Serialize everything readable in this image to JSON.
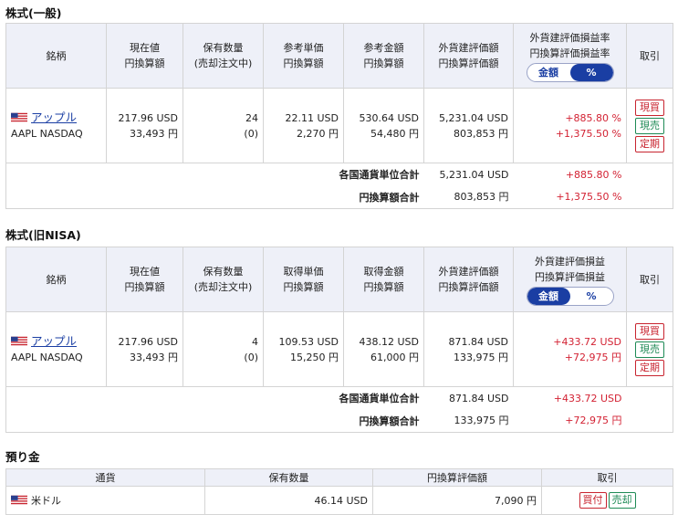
{
  "section1": {
    "title": "株式(一般)",
    "headers": {
      "name": "銘柄",
      "price": [
        "現在値",
        "円換算額"
      ],
      "qty": [
        "保有数量",
        "(売却注文中)"
      ],
      "unit": [
        "参考単価",
        "円換算額"
      ],
      "amount": [
        "参考金額",
        "円換算額"
      ],
      "eval": [
        "外貨建評価額",
        "円換算評価額"
      ],
      "pl": [
        "外貨建評価損益率",
        "円換算評価損益率"
      ],
      "trade": "取引"
    },
    "toggle": {
      "left": "金額",
      "right": "%",
      "active": "right"
    },
    "row": {
      "name": "アップル",
      "ticker": "AAPL NASDAQ",
      "price_usd": "217.96 USD",
      "price_jpy": "33,493 円",
      "qty": "24",
      "qty_selling": "(0)",
      "unit_usd": "22.11 USD",
      "unit_jpy": "2,270 円",
      "amount_usd": "530.64 USD",
      "amount_jpy": "54,480 円",
      "eval_usd": "5,231.04 USD",
      "eval_jpy": "803,853 円",
      "pl_usd": "+885.80 %",
      "pl_jpy": "+1,375.50 %",
      "btn_buy": "現買",
      "btn_sell": "現売",
      "btn_teiki": "定期"
    },
    "sum1": {
      "label": "各国通貨単位合計",
      "eval": "5,231.04 USD",
      "pl": "+885.80 %"
    },
    "sum2": {
      "label": "円換算額合計",
      "eval": "803,853 円",
      "pl": "+1,375.50 %"
    }
  },
  "section2": {
    "title": "株式(旧NISA)",
    "headers": {
      "name": "銘柄",
      "price": [
        "現在値",
        "円換算額"
      ],
      "qty": [
        "保有数量",
        "(売却注文中)"
      ],
      "unit": [
        "取得単価",
        "円換算額"
      ],
      "amount": [
        "取得金額",
        "円換算額"
      ],
      "eval": [
        "外貨建評価額",
        "円換算評価額"
      ],
      "pl": [
        "外貨建評価損益",
        "円換算評価損益"
      ],
      "trade": "取引"
    },
    "toggle": {
      "left": "金額",
      "right": "%",
      "active": "left"
    },
    "row": {
      "name": "アップル",
      "ticker": "AAPL NASDAQ",
      "price_usd": "217.96 USD",
      "price_jpy": "33,493 円",
      "qty": "4",
      "qty_selling": "(0)",
      "unit_usd": "109.53 USD",
      "unit_jpy": "15,250 円",
      "amount_usd": "438.12 USD",
      "amount_jpy": "61,000 円",
      "eval_usd": "871.84 USD",
      "eval_jpy": "133,975 円",
      "pl_usd": "+433.72 USD",
      "pl_jpy": "+72,975 円",
      "btn_buy": "現買",
      "btn_sell": "現売",
      "btn_teiki": "定期"
    },
    "sum1": {
      "label": "各国通貨単位合計",
      "eval": "871.84 USD",
      "pl": "+433.72 USD"
    },
    "sum2": {
      "label": "円換算額合計",
      "eval": "133,975 円",
      "pl": "+72,975 円"
    }
  },
  "section3": {
    "title": "預り金",
    "headers": {
      "currency": "通貨",
      "qty": "保有数量",
      "eval": "円換算評価額",
      "trade": "取引"
    },
    "row": {
      "currency": "米ドル",
      "qty": "46.14 USD",
      "eval": "7,090 円",
      "btn_buy": "買付",
      "btn_sell": "売却"
    }
  },
  "icons": {
    "flag": "us-flag-icon"
  },
  "colors": {
    "accent": "#1a3ea3",
    "positive": "#d32233",
    "buy": "#c8242f",
    "sell": "#1e8a55",
    "header_bg": "#eef0f8"
  }
}
